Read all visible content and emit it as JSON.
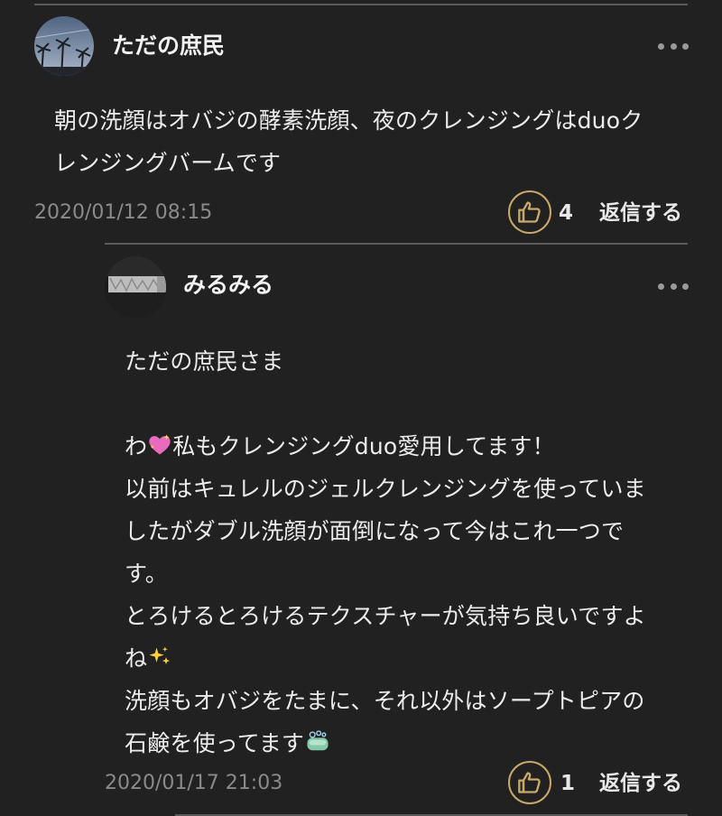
{
  "comments": [
    {
      "author": "ただの庶民",
      "lines": [
        "朝の洗顔はオバジの酵素洗顔、夜のクレンジングはduoク",
        "レンジングバームです"
      ],
      "timestamp": "2020/01/12 08:15",
      "likes": "4",
      "reply_label": "返信する",
      "more_icon": "more-dots-icon"
    },
    {
      "author": "みるみる",
      "greeting": "ただの庶民さま",
      "line_1_prefix": "わ",
      "line_1_emoji": "sparkling-heart-icon",
      "line_1_rest": "私もクレンジングduo愛用してます！",
      "line_2": "以前はキュレルのジェルクレンジングを使っていま",
      "line_3": "したがダブル洗顔が面倒になって今はこれ一つで",
      "line_4": "す。",
      "line_5": "とろけるとろけるテクスチャーが気持ち良いですよ",
      "line_6_text": "ね",
      "line_6_emoji": "sparkles-icon",
      "line_7": "洗顔もオバジをたまに、それ以外はソープトピアの",
      "line_8_text": "石鹸を使ってます",
      "line_8_emoji": "soap-icon",
      "timestamp": "2020/01/17 21:03",
      "likes": "1",
      "reply_label": "返信する"
    }
  ],
  "colors": {
    "background": "#212121",
    "accent_like_border": "#c9a96a",
    "timestamp": "#8a8a8a",
    "divider": "#5a5a5a"
  }
}
